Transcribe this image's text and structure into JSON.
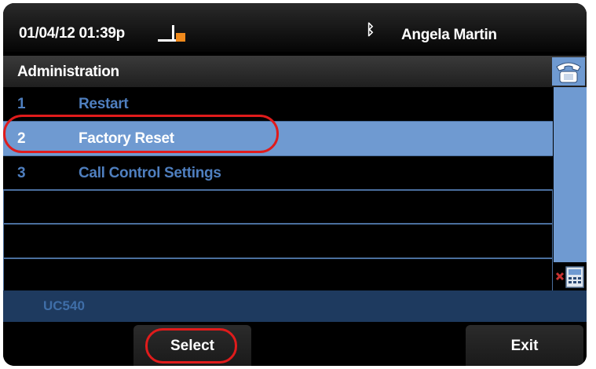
{
  "status_bar": {
    "datetime": "01/04/12 01:39p",
    "line_icon": "line-status-icon",
    "bluetooth_icon": "bluetooth-icon",
    "bluetooth_glyph": "ᛒ",
    "user_name": "Angela Martin"
  },
  "header": {
    "title": "Administration",
    "phone_icon": "phone-icon"
  },
  "menu": {
    "items": [
      {
        "number": "1",
        "label": "Restart"
      },
      {
        "number": "2",
        "label": "Factory Reset"
      },
      {
        "number": "3",
        "label": "Call Control Settings"
      }
    ],
    "selected_number": "2"
  },
  "footer": {
    "label": "UC540"
  },
  "softkeys": {
    "select_label": "Select",
    "exit_label": "Exit"
  },
  "colors": {
    "accent": "#6f9ad1",
    "menu_text": "#4f7fbf",
    "highlight": "#e01b1b",
    "footer_bg": "#1e3a5f"
  }
}
